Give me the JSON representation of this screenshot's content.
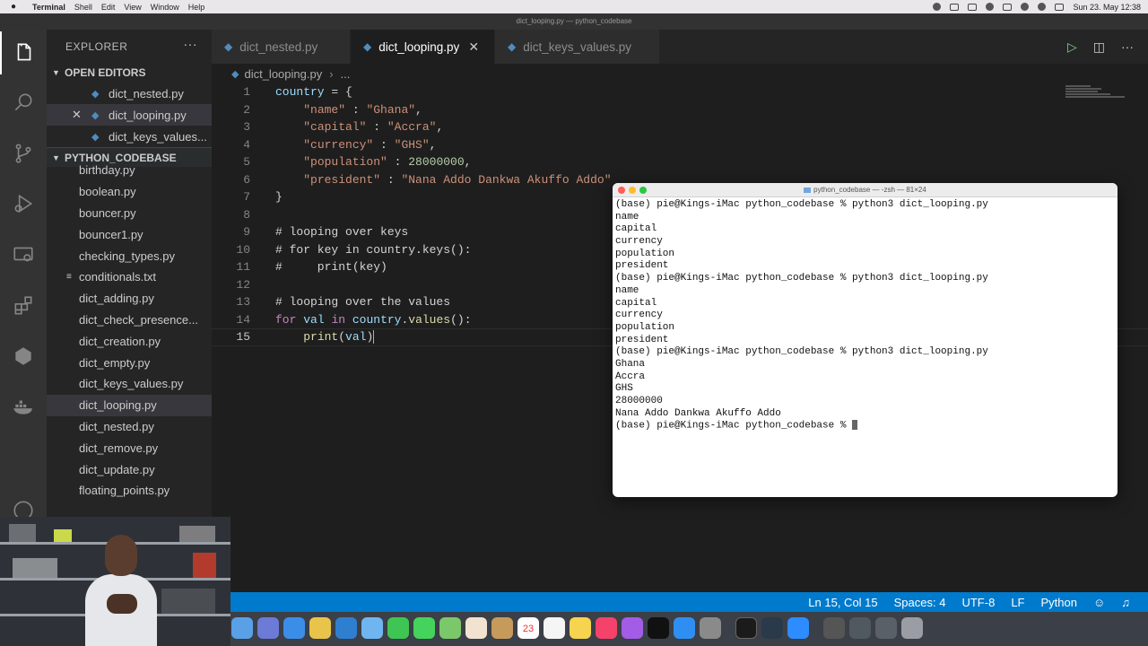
{
  "menubar": {
    "app": "Terminal",
    "items": [
      "Shell",
      "Edit",
      "View",
      "Window",
      "Help"
    ],
    "datetime": "Sun 23. May 12:38"
  },
  "window_title": "dict_looping.py — python_codebase",
  "explorer": {
    "title": "EXPLORER",
    "more": "···",
    "open_editors_label": "OPEN EDITORS",
    "open_editors": [
      "dict_nested.py",
      "dict_looping.py",
      "dict_keys_values..."
    ],
    "project_label": "PYTHON_CODEBASE",
    "files": [
      "birthday.py",
      "boolean.py",
      "bouncer.py",
      "bouncer1.py",
      "checking_types.py",
      "conditionals.txt",
      "dict_adding.py",
      "dict_check_presence...",
      "dict_creation.py",
      "dict_empty.py",
      "dict_keys_values.py",
      "dict_looping.py",
      "dict_nested.py",
      "dict_remove.py",
      "dict_update.py",
      "floating_points.py"
    ],
    "active_file": "dict_looping.py"
  },
  "tabs": [
    "dict_nested.py",
    "dict_looping.py",
    "dict_keys_values.py"
  ],
  "active_tab": "dict_looping.py",
  "breadcrumb": {
    "file": "dict_looping.py",
    "rest": "..."
  },
  "editor": {
    "line_numbers": [
      "1",
      "2",
      "3",
      "4",
      "5",
      "6",
      "7",
      "8",
      "9",
      "10",
      "11",
      "12",
      "13",
      "14",
      "15"
    ],
    "current_line": "15"
  },
  "terminal": {
    "title": "python_codebase — -zsh — 81×24",
    "lines": [
      "(base) pie@Kings-iMac python_codebase % python3 dict_looping.py",
      "name",
      "capital",
      "currency",
      "population",
      "president",
      "(base) pie@Kings-iMac python_codebase % python3 dict_looping.py",
      "name",
      "capital",
      "currency",
      "population",
      "president",
      "(base) pie@Kings-iMac python_codebase % python3 dict_looping.py",
      "Ghana",
      "Accra",
      "GHS",
      "28000000",
      "Nana Addo Dankwa Akuffo Addo"
    ],
    "prompt": "(base) pie@Kings-iMac python_codebase % "
  },
  "statusbar": {
    "position": "Ln 15, Col 15",
    "spaces": "Spaces: 4",
    "encoding": "UTF-8",
    "eol": "LF",
    "language": "Python"
  },
  "dock": {
    "calendar_day": "23"
  }
}
